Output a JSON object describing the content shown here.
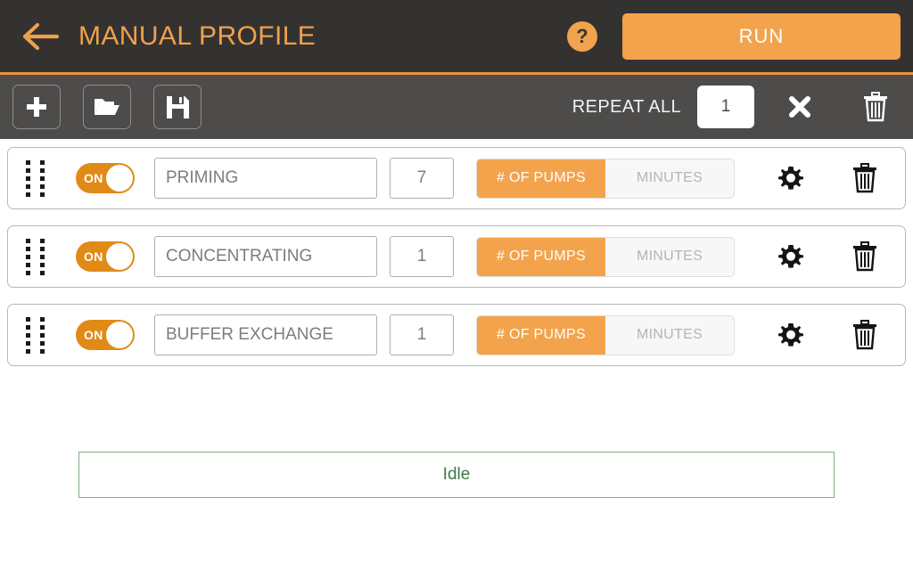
{
  "header": {
    "back_icon": "arrow-left-icon",
    "title": "MANUAL PROFILE",
    "help_icon_label": "?",
    "run_label": "RUN",
    "accent_color": "#f2a34c",
    "bg_color": "#333231"
  },
  "toolbar": {
    "add_icon": "plus-icon",
    "open_icon": "folder-open-icon",
    "save_icon": "floppy-disk-icon",
    "repeat_label": "REPEAT ALL",
    "repeat_value": "1",
    "close_icon": "x-icon",
    "trash_icon": "trash-icon",
    "bg_color": "#4d4c4b"
  },
  "rows": [
    {
      "toggle_label": "ON",
      "toggle_on": true,
      "name": "PRIMING",
      "value": "7",
      "mode_options": [
        "# OF PUMPS",
        "MINUTES"
      ],
      "mode_selected": "# OF PUMPS",
      "gear_icon": "gear-icon",
      "trash_icon": "trash-icon"
    },
    {
      "toggle_label": "ON",
      "toggle_on": true,
      "name": "CONCENTRATING",
      "value": "1",
      "mode_options": [
        "# OF PUMPS",
        "MINUTES"
      ],
      "mode_selected": "# OF PUMPS",
      "gear_icon": "gear-icon",
      "trash_icon": "trash-icon"
    },
    {
      "toggle_label": "ON",
      "toggle_on": true,
      "name": "BUFFER EXCHANGE",
      "value": "1",
      "mode_options": [
        "# OF PUMPS",
        "MINUTES"
      ],
      "mode_selected": "# OF PUMPS",
      "gear_icon": "gear-icon",
      "trash_icon": "trash-icon"
    }
  ],
  "status": {
    "text": "Idle",
    "border_color": "#83a983",
    "text_color": "#3f7a46"
  }
}
